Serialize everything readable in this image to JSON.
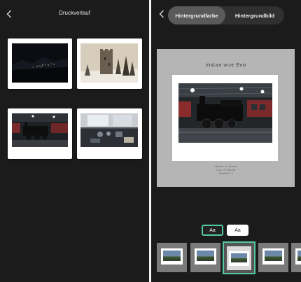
{
  "left_panel": {
    "title": "Druckverlauf",
    "prints": [
      {
        "subject": "night-landscape"
      },
      {
        "subject": "tower-ruin-in-snow"
      },
      {
        "subject": "steam-locomotive"
      },
      {
        "subject": "locomotive-cab"
      }
    ]
  },
  "right_panel": {
    "tabs": [
      {
        "label": "Hintergrundfarbe",
        "active": true
      },
      {
        "label": "Hintergrundbild",
        "active": false
      }
    ],
    "preview": {
      "brand_prefix": "instax ",
      "brand_middle": "WIDE",
      "brand_suffix": " Evo",
      "info_lines": [
        "Objektiv : A / Normal",
        "Lens : A / Normal",
        "Filmeffekt : 0"
      ]
    },
    "text_style_buttons": [
      {
        "label": "Aa",
        "style": "dark",
        "selected": true
      },
      {
        "label": "Aa",
        "style": "light",
        "selected": false
      }
    ],
    "thumbnails_count": 5,
    "selected_thumbnail": 3
  },
  "colors": {
    "accent": "#54c7a4",
    "panel_bg": "#1b1b1b",
    "preview_bg": "#b5b5b5"
  }
}
